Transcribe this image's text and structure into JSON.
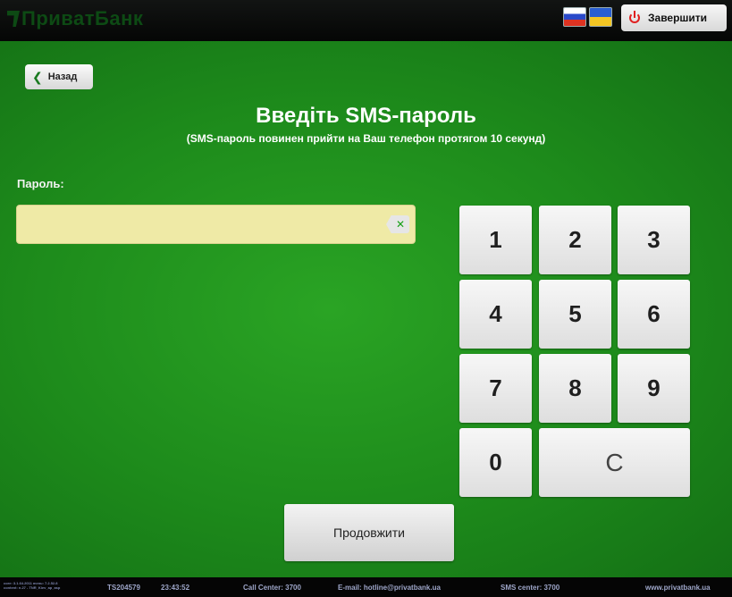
{
  "header": {
    "logo_text": "ПриватБанк",
    "flags": [
      "flag-ru",
      "flag-ua"
    ],
    "exit_label": "Завершити"
  },
  "nav": {
    "back_label": "Назад"
  },
  "main": {
    "title": "Введіть SMS-пароль",
    "subtitle": "(SMS-пароль повинен прийти на Ваш телефон протягом 10 секунд)",
    "password_label": "Пароль:",
    "password_value": ""
  },
  "keypad": {
    "keys": [
      "1",
      "2",
      "3",
      "4",
      "5",
      "6",
      "7",
      "8",
      "9",
      "0"
    ],
    "clear": "С"
  },
  "continue_label": "Продовжити",
  "footer": {
    "version_line1": "core: 3.1.64.2011  menu: 7.2.52.8",
    "version_line2": "content: n.27 - TNR_Kiev_ap_asp",
    "terminal": "TS204579",
    "time": "23:43:52",
    "call_center": "Call Center: 3700",
    "email": "E-mail: hotline@privatbank.ua",
    "sms_center": "SMS center: 3700",
    "website": "www.privatbank.ua"
  },
  "colors": {
    "accent_green": "#1d8a1b",
    "field_yellow": "#efeaa6",
    "exit_red": "#e02020"
  }
}
